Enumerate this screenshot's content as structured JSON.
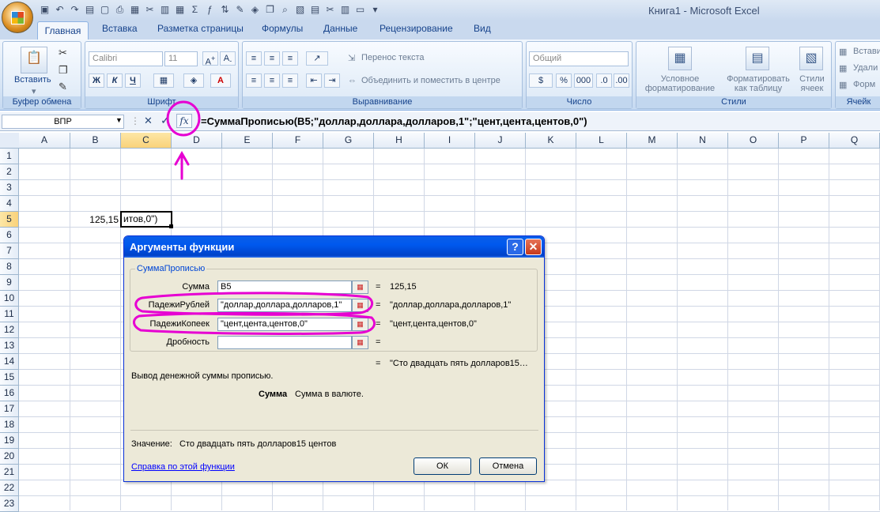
{
  "window": {
    "title": "Книга1 - Microsoft Excel"
  },
  "ribbon": {
    "tabs": [
      "Главная",
      "Вставка",
      "Разметка страницы",
      "Формулы",
      "Данные",
      "Рецензирование",
      "Вид"
    ],
    "clipboard": {
      "paste": "Вставить",
      "label": "Буфер обмена"
    },
    "font": {
      "name": "Calibri",
      "size": "11",
      "label": "Шрифт",
      "bold": "Ж",
      "italic": "К",
      "underline": "Ч"
    },
    "alignment": {
      "wrap": "Перенос текста",
      "merge": "Объединить и поместить в центре",
      "label": "Выравнивание"
    },
    "number": {
      "format": "Общий",
      "label": "Число",
      "percent": "%",
      "thousands": "000"
    },
    "styles": {
      "conditional": "Условное форматирование",
      "as_table": "Форматировать как таблицу",
      "cell_styles": "Стили ячеек",
      "label": "Стили"
    },
    "cells": {
      "insert": "Встави",
      "delete": "Удали",
      "format": "Форм",
      "label": "Ячейк"
    }
  },
  "formula_bar": {
    "name_box": "ВПР",
    "formula": "=СуммаПрописью(B5;\"доллар,доллара,долларов,1\";\"цент,цента,центов,0\")"
  },
  "grid": {
    "columns": [
      "A",
      "B",
      "C",
      "D",
      "E",
      "F",
      "G",
      "H",
      "I",
      "J",
      "K",
      "L",
      "M",
      "N",
      "O",
      "P",
      "Q"
    ],
    "rows": [
      "1",
      "2",
      "3",
      "4",
      "5",
      "6",
      "7",
      "8",
      "9",
      "10",
      "11",
      "12",
      "13",
      "14",
      "15",
      "16",
      "17",
      "18",
      "19",
      "20",
      "21",
      "22",
      "23"
    ],
    "b5": "125,15",
    "c5": "итов,0\")"
  },
  "dialog": {
    "title": "Аргументы функции",
    "function_name": "СуммаПрописью",
    "args": [
      {
        "label": "Сумма",
        "value": "B5",
        "result": "125,15"
      },
      {
        "label": "ПадежиРублей",
        "value": "\"доллар,доллара,долларов,1\"",
        "result": "\"доллар,доллара,долларов,1\""
      },
      {
        "label": "ПадежиКопеек",
        "value": "\"цент,цента,центов,0\"",
        "result": "\"цент,цента,центов,0\""
      },
      {
        "label": "Дробность",
        "value": "",
        "result": ""
      }
    ],
    "equals": "=",
    "total_result": "\"Сто двадцать пять долларов15…",
    "description": "Вывод денежной суммы прописью.",
    "arg_help_name": "Сумма",
    "arg_help_text": "Сумма в валюте.",
    "value_label": "Значение:",
    "value_text": "Сто двадцать пять долларов15 центов",
    "help_link": "Справка по этой функции",
    "ok": "ОК",
    "cancel": "Отмена"
  },
  "colors": {
    "annotation": "#e600d2",
    "dialog_title": "#0058ee"
  }
}
